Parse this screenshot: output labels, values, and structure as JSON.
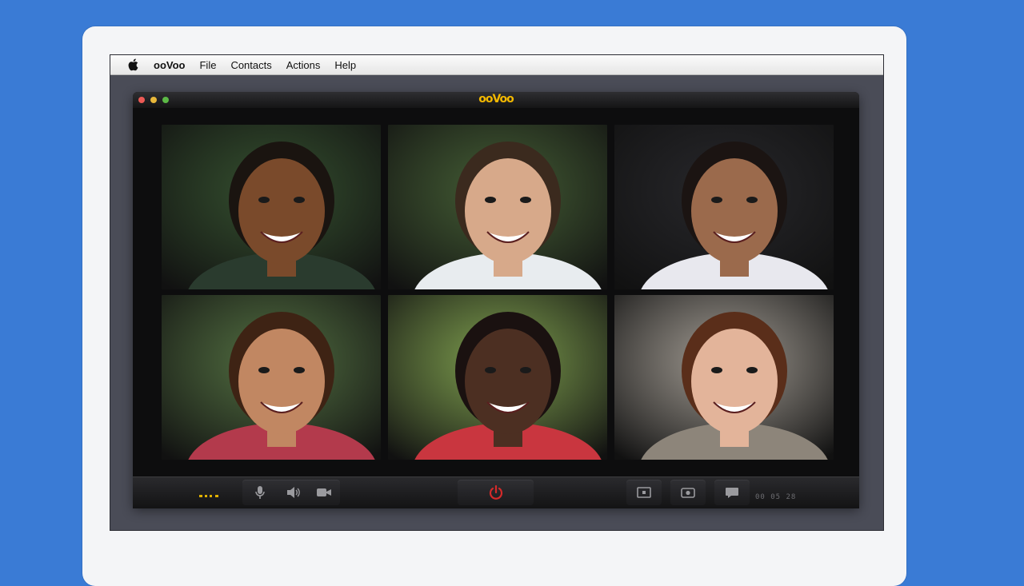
{
  "menubar": {
    "items": [
      "ooVoo",
      "File",
      "Contacts",
      "Actions",
      "Help"
    ]
  },
  "window": {
    "brand": "ooVoo",
    "traffic_lights": [
      "#ed5a55",
      "#e8b73a",
      "#5cb946"
    ]
  },
  "video_tiles": [
    {
      "id": "p1",
      "bg": "#3b5a34",
      "skin": "#7a4a2b",
      "hair": "#1a1410",
      "shirt": "#2a3b2e"
    },
    {
      "id": "p2",
      "bg": "#4d6a3b",
      "skin": "#d7a98a",
      "hair": "#3b2a1e",
      "shirt": "#e8ecef"
    },
    {
      "id": "p3",
      "bg": "#2b2b2f",
      "skin": "#9b6a4c",
      "hair": "#1b1412",
      "shirt": "#e8e8ee"
    },
    {
      "id": "p4",
      "bg": "#5d7e49",
      "skin": "#c18762",
      "hair": "#3e2314",
      "shirt": "#b33a4c"
    },
    {
      "id": "p5",
      "bg": "#8fb458",
      "skin": "#4c2f22",
      "hair": "#1a1110",
      "shirt": "#c9363f"
    },
    {
      "id": "p6",
      "bg": "#b7b0a6",
      "skin": "#e3b49a",
      "hair": "#5a2e1a",
      "shirt": "#8d857a"
    }
  ],
  "controls": {
    "timer": "00 05 28",
    "accent": "#d42a2a",
    "buttons": [
      "microphone-icon",
      "speaker-icon",
      "video-camera-icon",
      "power-icon",
      "screen-share-icon",
      "snapshot-icon",
      "chat-icon"
    ]
  }
}
